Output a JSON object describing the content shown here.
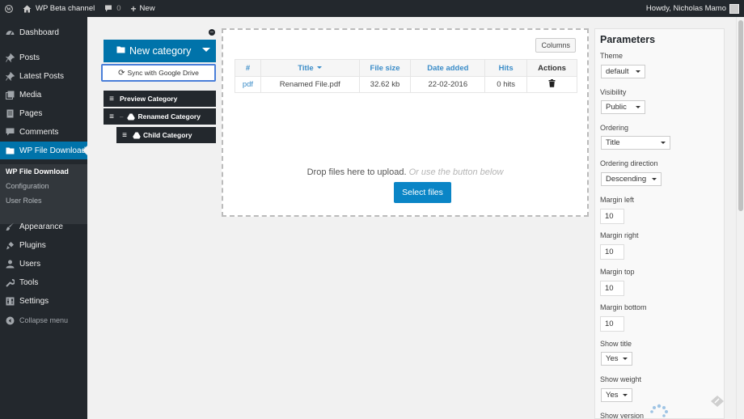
{
  "adminbar": {
    "site_name": "WP Beta channel",
    "comments_count": "0",
    "new_label": "New",
    "howdy": "Howdy, Nicholas Mamo"
  },
  "sidebar": {
    "items": [
      {
        "label": "Dashboard",
        "icon": "dashboard-icon"
      },
      {
        "label": "Posts",
        "icon": "pin-icon"
      },
      {
        "label": "Latest Posts",
        "icon": "pin-icon"
      },
      {
        "label": "Media",
        "icon": "media-icon"
      },
      {
        "label": "Pages",
        "icon": "pages-icon"
      },
      {
        "label": "Comments",
        "icon": "comment-icon"
      },
      {
        "label": "WP File Download",
        "icon": "folder-icon"
      },
      {
        "label": "Appearance",
        "icon": "brush-icon"
      },
      {
        "label": "Plugins",
        "icon": "plug-icon"
      },
      {
        "label": "Users",
        "icon": "user-icon"
      },
      {
        "label": "Tools",
        "icon": "wrench-icon"
      },
      {
        "label": "Settings",
        "icon": "settings-icon"
      }
    ],
    "submenu": [
      "WP File Download",
      "Configuration",
      "User Roles"
    ],
    "collapse_label": "Collapse menu"
  },
  "categories": {
    "new_button": "New category",
    "sync_button": "Sync with Google Drive",
    "tree": [
      {
        "label": "Preview Category"
      },
      {
        "label": "Renamed Category"
      },
      {
        "label": "Child Category"
      }
    ]
  },
  "files": {
    "columns_button": "Columns",
    "headers": {
      "ext": "#",
      "title": "Title",
      "size": "File size",
      "date": "Date added",
      "hits": "Hits",
      "actions": "Actions"
    },
    "rows": [
      {
        "ext": "pdf",
        "title": "Renamed File.pdf",
        "size": "32.62 kb",
        "date": "22-02-2016",
        "hits": "0 hits"
      }
    ],
    "drop_text": "Drop files here to upload.",
    "drop_hint": "Or use the button below",
    "select_button": "Select files"
  },
  "params": {
    "title": "Parameters",
    "theme": {
      "label": "Theme",
      "value": "default"
    },
    "visibility": {
      "label": "Visibility",
      "value": "Public"
    },
    "ordering": {
      "label": "Ordering",
      "value": "Title"
    },
    "ordering_direction": {
      "label": "Ordering direction",
      "value": "Descending"
    },
    "margin_left": {
      "label": "Margin left",
      "value": "10"
    },
    "margin_right": {
      "label": "Margin right",
      "value": "10"
    },
    "margin_top": {
      "label": "Margin top",
      "value": "10"
    },
    "margin_bottom": {
      "label": "Margin bottom",
      "value": "10"
    },
    "show_title": {
      "label": "Show title",
      "value": "Yes"
    },
    "show_weight": {
      "label": "Show weight",
      "value": "Yes"
    },
    "show_version": {
      "label": "Show version"
    }
  },
  "colors": {
    "admin_dark": "#23282d",
    "accent": "#0073aa",
    "link": "#3a8cc8"
  }
}
